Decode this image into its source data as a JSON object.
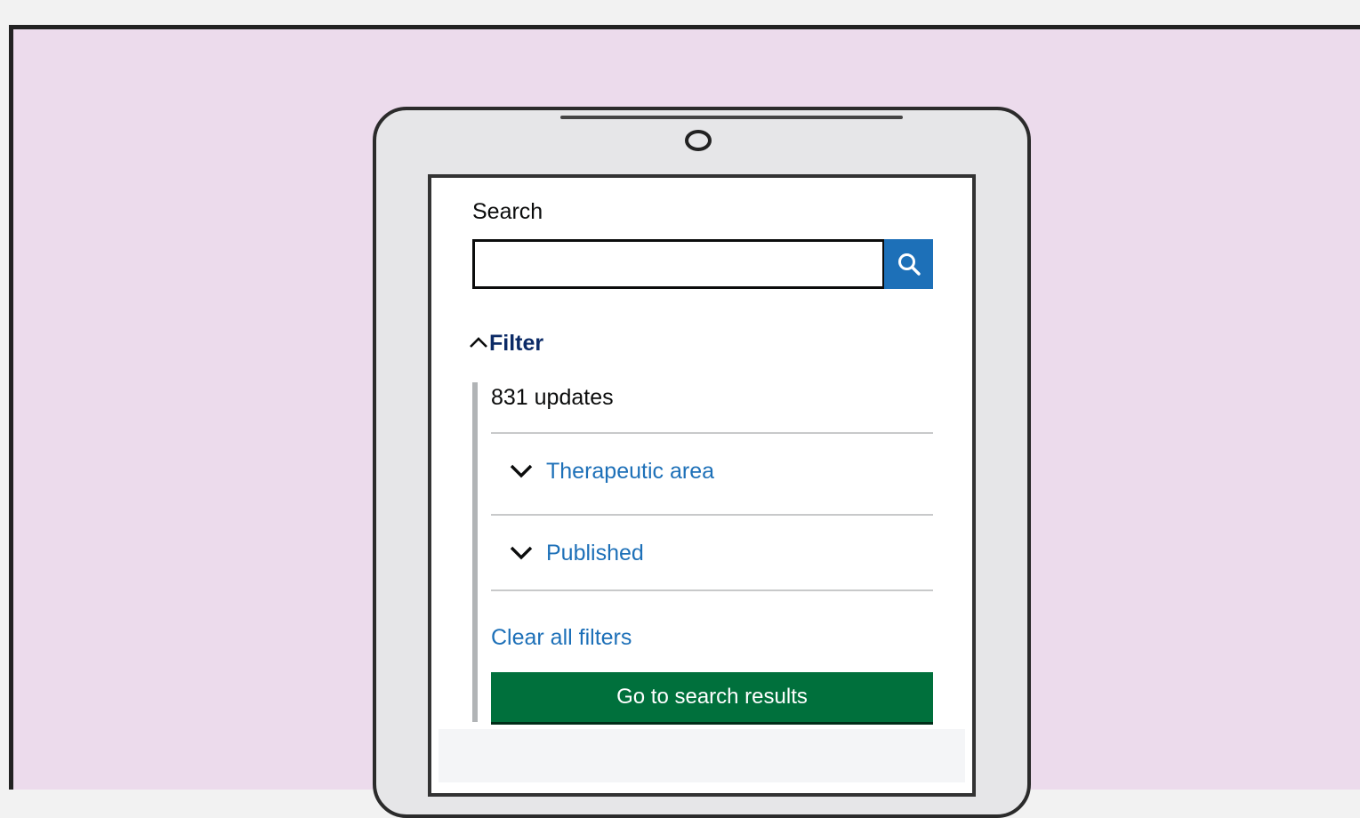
{
  "search": {
    "label": "Search",
    "value": "",
    "placeholder": "",
    "button_icon": "search-icon"
  },
  "filter": {
    "toggle_label": "Filter",
    "toggle_icon": "chevron-up-icon",
    "result_count": "831 updates",
    "sections": [
      {
        "label": "Therapeutic area",
        "icon": "chevron-down-icon"
      },
      {
        "label": "Published",
        "icon": "chevron-down-icon"
      }
    ],
    "clear_label": "Clear all filters",
    "submit_label": "Go to search results"
  },
  "colors": {
    "background": "#ecdbec",
    "link": "#1d70b8",
    "search_button": "#1d70b8",
    "primary_button": "#00703c",
    "filter_heading": "#0b2a66"
  }
}
